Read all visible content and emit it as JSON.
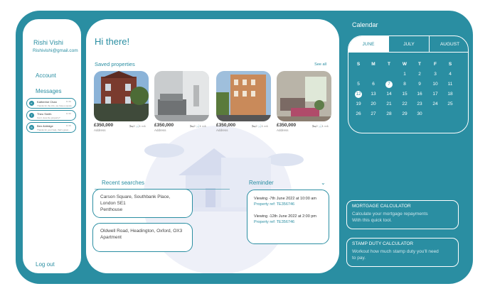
{
  "user": {
    "name": "Rishi Vishi",
    "email": "Rishivishi@gmail.com"
  },
  "nav": {
    "account": "Account",
    "messages": "Messages",
    "logout": "Log out"
  },
  "messages": [
    {
      "name": "Katherine Chan",
      "preview": "Thanks for the info, we have a spare...",
      "time": "11:30",
      "initial": "K"
    },
    {
      "name": "Theo Smith",
      "preview": "Can I view the property?",
      "time": "11:30",
      "initial": "T"
    },
    {
      "name": "Ben Aldridge",
      "preview": "Thanks for your help, that's great...",
      "time": "11:30",
      "initial": "B"
    }
  ],
  "main": {
    "greeting": "Hi there!",
    "saved_title": "Saved properties",
    "see_all": "See all",
    "properties": [
      {
        "price": "£350,000",
        "address": "Address",
        "icons": "🛏2 🛁1 ▭1"
      },
      {
        "price": "£350,000",
        "address": "Address",
        "icons": "🛏2 🛁1 ▭1"
      },
      {
        "price": "£350,000",
        "address": "Address",
        "icons": "🛏2 🛁1 ▭1"
      },
      {
        "price": "£350,000",
        "address": "Address",
        "icons": "🛏2 🛁1 ▭1"
      }
    ],
    "recent_title": "Recent searches",
    "searches": [
      {
        "line1": "Carson Square, Southbank Place, London SE1",
        "line2": "Penthouse"
      },
      {
        "line1": "Oldwell Road, Headington, Oxford, OX3",
        "line2": "Apartment"
      }
    ],
    "reminder_title": "Reminder",
    "reminders": [
      {
        "label": "Viewing",
        "when": " -7th June 2022 at 10:00 am",
        "ref": "Property ref: TE356746"
      },
      {
        "label": "Viewing",
        "when": " -12th June 2022 at 2:00 pm",
        "ref": "Property ref: TE356746"
      }
    ]
  },
  "calendar": {
    "title": "Calendar",
    "months": [
      "JUNE",
      "JULY",
      "AUGUST"
    ],
    "active_month": "JUNE",
    "weekdays": [
      "S",
      "M",
      "T",
      "W",
      "T",
      "F",
      "S"
    ],
    "weeks": [
      [
        "",
        "",
        "",
        "1",
        "2",
        "3",
        "4"
      ],
      [
        "5",
        "6",
        "7",
        "8",
        "9",
        "10",
        "11"
      ],
      [
        "12",
        "13",
        "14",
        "15",
        "16",
        "17",
        "18"
      ],
      [
        "19",
        "20",
        "21",
        "22",
        "23",
        "24",
        "25"
      ],
      [
        "26",
        "27",
        "28",
        "29",
        "30",
        "",
        ""
      ]
    ],
    "today": "12",
    "selected": "7"
  },
  "calculators": [
    {
      "title": "MORTGAGE CALCULATOR",
      "desc1": "Calculate your mortgage repayments",
      "desc2": "With this quick tool."
    },
    {
      "title": "STAMP DUTY CALCULATOR",
      "desc1": "Workout how much stamp duty you'll need",
      "desc2": "to pay."
    }
  ]
}
